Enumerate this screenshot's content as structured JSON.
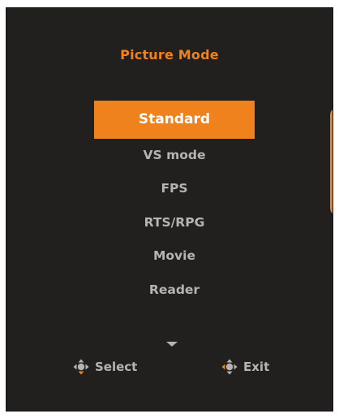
{
  "menu": {
    "title": "Picture Mode",
    "items": [
      {
        "label": "Standard",
        "selected": true
      },
      {
        "label": "VS mode",
        "selected": false
      },
      {
        "label": "FPS",
        "selected": false
      },
      {
        "label": "RTS/RPG",
        "selected": false
      },
      {
        "label": "Movie",
        "selected": false
      },
      {
        "label": "Reader",
        "selected": false
      }
    ]
  },
  "hints": {
    "select": {
      "label": "Select",
      "icon": "joystick-down-highlight-icon"
    },
    "exit": {
      "label": "Exit",
      "icon": "joystick-left-highlight-icon"
    }
  },
  "colors": {
    "panel": "#221f1f",
    "accent": "#f0821e",
    "text": "#b7b3b3",
    "selected_text": "#ffffff"
  }
}
